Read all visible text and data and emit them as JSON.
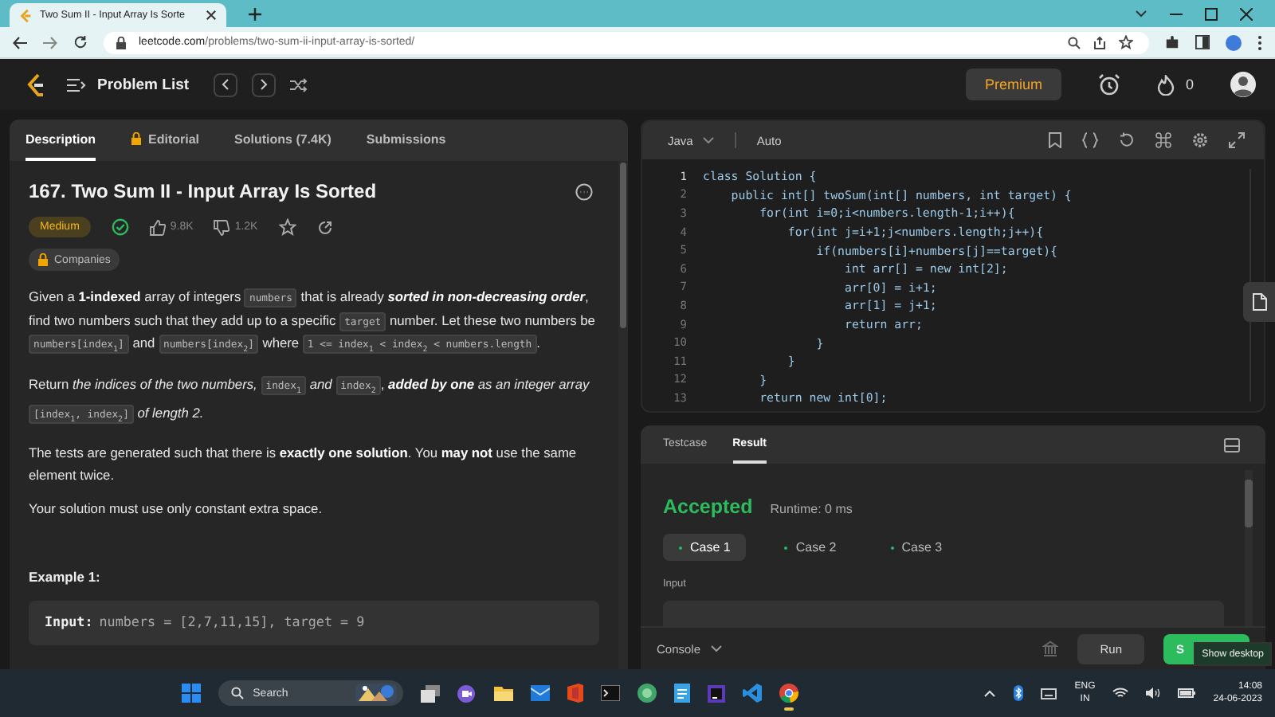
{
  "browser": {
    "tab_title": "Two Sum II - Input Array Is Sorte",
    "url_host": "leetcode.com",
    "url_path": "/problems/two-sum-ii-input-array-is-sorted/"
  },
  "nav": {
    "title": "Problem List",
    "premium": "Premium",
    "streak": "0"
  },
  "left_tabs": [
    {
      "label": "Description",
      "selected": true,
      "locked": false
    },
    {
      "label": "Editorial",
      "selected": false,
      "locked": true
    },
    {
      "label": "Solutions (7.4K)",
      "selected": false,
      "locked": false
    },
    {
      "label": "Submissions",
      "selected": false,
      "locked": false
    }
  ],
  "problem": {
    "title": "167. Two Sum II - Input Array Is Sorted",
    "difficulty": "Medium",
    "solved": true,
    "likes": "9.8K",
    "dislikes": "1.2K",
    "companies": "Companies",
    "paragraphs": [
      [
        {
          "kind": "text",
          "text": "Given a **1-indexed** array of integers "
        },
        {
          "kind": "code",
          "text": "numbers"
        },
        {
          "kind": "text",
          "text": " that is already "
        },
        {
          "kind": "emphasis",
          "text": "sorted in non-decreasing order"
        },
        {
          "kind": "text",
          "text": ", find two numbers such that they add up to a specific "
        },
        {
          "kind": "code",
          "text": "target"
        },
        {
          "kind": "text",
          "text": " number. Let these two numbers be "
        },
        {
          "kind": "code",
          "text": "numbers[index$_{1}$]"
        },
        {
          "kind": "text",
          "text": " and "
        },
        {
          "kind": "code",
          "text": "numbers[index$_{2}$]"
        },
        {
          "kind": "text",
          "text": " where "
        },
        {
          "kind": "code",
          "text": "1 <= index$_{1}$ < index$_{2}$ < numbers.length"
        },
        {
          "kind": "text",
          "text": "."
        }
      ],
      [
        {
          "kind": "text",
          "text": "Return *the indices of the two numbers,* "
        },
        {
          "kind": "code",
          "text": "index$_{1}$"
        },
        {
          "kind": "text",
          "text": " *and* "
        },
        {
          "kind": "code",
          "text": "index$_{2}$"
        },
        {
          "kind": "text",
          "text": ", "
        },
        {
          "kind": "emphasis",
          "text": "added by one"
        },
        {
          "kind": "text",
          "text": " *as an integer array* "
        },
        {
          "kind": "code",
          "text": "[index$_{1}$, index$_{2}$]"
        },
        {
          "kind": "text",
          "text": " *of length 2.*"
        }
      ],
      [
        {
          "kind": "text",
          "text": "The tests are generated such that there is **exactly one solution**. You **may not** use the same element twice."
        }
      ],
      [
        {
          "kind": "text",
          "text": "Your solution must use only constant extra space."
        }
      ]
    ],
    "example_heading": "Example 1:",
    "example_label": "Input:",
    "example_text": "numbers = [2,7,11,15], target = 9"
  },
  "editor": {
    "language": "Java",
    "mode": "Auto",
    "lines": [
      {
        "number": "1",
        "code": "class Solution {"
      },
      {
        "number": "2",
        "code": "    public int[] twoSum(int[] numbers, int target) {"
      },
      {
        "number": "3",
        "code": "        for(int i=0;i<numbers.length-1;i++){"
      },
      {
        "number": "4",
        "code": "            for(int j=i+1;j<numbers.length;j++){"
      },
      {
        "number": "5",
        "code": "                if(numbers[i]+numbers[j]==target){"
      },
      {
        "number": "6",
        "code": "                    int arr[] = new int[2];"
      },
      {
        "number": "7",
        "code": "                    arr[0] = i+1;"
      },
      {
        "number": "8",
        "code": "                    arr[1] = j+1;"
      },
      {
        "number": "9",
        "code": "                    return arr;"
      },
      {
        "number": "10",
        "code": "                }"
      },
      {
        "number": "11",
        "code": "            }"
      },
      {
        "number": "12",
        "code": "        }"
      },
      {
        "number": "13",
        "code": "        return new int[0];"
      }
    ]
  },
  "result": {
    "tabs": [
      {
        "label": "Testcase",
        "selected": false
      },
      {
        "label": "Result",
        "selected": true
      }
    ],
    "status": "Accepted",
    "runtime": "Runtime: 0 ms",
    "cases": [
      {
        "label": "Case 1",
        "selected": true
      },
      {
        "label": "Case 2",
        "selected": false
      },
      {
        "label": "Case 3",
        "selected": false
      }
    ],
    "input_label": "Input"
  },
  "console": {
    "label": "Console",
    "run": "Run",
    "submit": "S"
  },
  "tooltip": "Show desktop",
  "taskbar": {
    "search": "Search",
    "language": "ENG",
    "region": "IN",
    "time": "14:08",
    "date": "24-06-2023"
  }
}
